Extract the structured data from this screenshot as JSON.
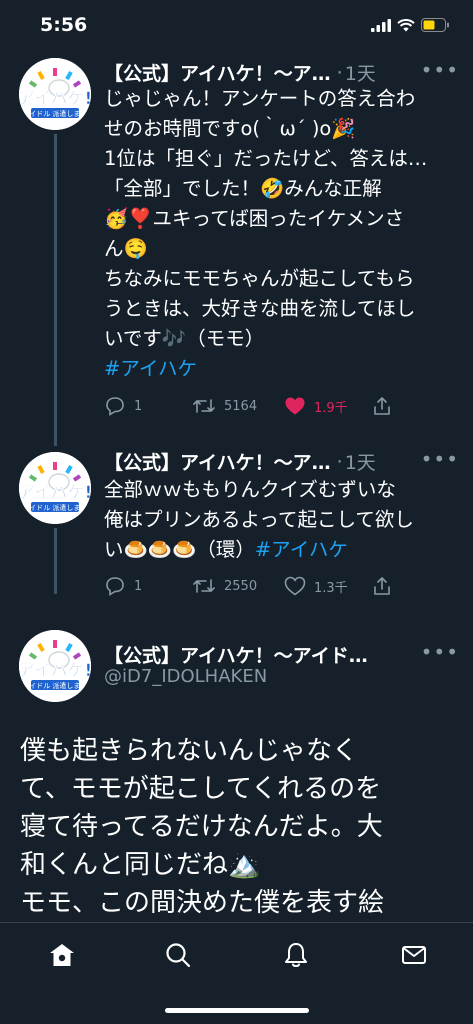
{
  "status": {
    "time": "5:56"
  },
  "tweets": [
    {
      "author": "【公式】アイハケ！〜ア…",
      "time": "1天",
      "body_lines": [
        "じゃじゃん！アンケートの答え合わ",
        "せのお時間ですo(｀ω´ )o🎉",
        "1位は「担ぐ」だったけど、答えは…",
        "「全部」でした！🤣みんな正解",
        "🥳❣️ユキってば困ったイケメンさ",
        "ん🤤",
        "ちなみにモモちゃんが起こしてもら",
        "うときは、大好きな曲を流してほし",
        "いです🎶（モモ）"
      ],
      "hashtag": "#アイハケ",
      "replies": "1",
      "retweets": "5164",
      "likes": "1.9千"
    },
    {
      "author": "【公式】アイハケ！〜ア…",
      "time": "1天",
      "body_lines": [
        "全部ｗｗももりんクイズむずいな",
        "俺はプリンあるよって起こして欲し",
        "い🍮🍮🍮（環）"
      ],
      "hashtag": "#アイハケ",
      "replies": "1",
      "retweets": "2550",
      "likes": "1.3千"
    }
  ],
  "main_tweet": {
    "author": "【公式】アイハケ！〜アイド…",
    "handle": "@iD7_IDOLHAKEN",
    "body_lines": [
      "僕も起きられないんじゃなく",
      "て、モモが起こしてくれるのを",
      "寝て待ってるだけなんだよ。大",
      "和くんと同じだね🏔️",
      "モモ、この間決めた僕を表す絵"
    ]
  },
  "colors": {
    "background": "#15202b",
    "hashtag": "#1da1f2",
    "muted": "#8899a6",
    "like": "#e0245e"
  },
  "icons": [
    "home-icon",
    "search-icon",
    "notifications-icon",
    "messages-icon",
    "reply-icon",
    "retweet-icon",
    "like-icon",
    "share-icon",
    "more-icon"
  ]
}
